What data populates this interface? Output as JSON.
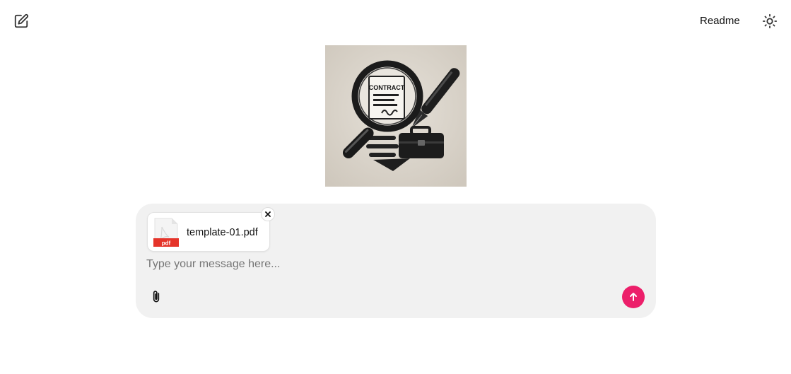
{
  "header": {
    "new_chat_icon": "pencil-square-icon",
    "readme_label": "Readme",
    "theme_icon": "sun-icon"
  },
  "hero": {
    "image_subject": "magnifying glass over contract with pen and briefcase",
    "contract_word": "CONTRACT"
  },
  "composer": {
    "attachments": [
      {
        "file_name": "template-01.pdf",
        "file_type": "pdf",
        "remove_icon": "close-icon"
      }
    ],
    "input": {
      "value": "",
      "placeholder": "Type your message here..."
    },
    "attach_icon": "paperclip-icon",
    "send_icon": "arrow-up-icon"
  },
  "colors": {
    "accent": "#ec1f6a",
    "composer_bg": "#f1f1f1",
    "pdf_badge": "#e5342a"
  }
}
